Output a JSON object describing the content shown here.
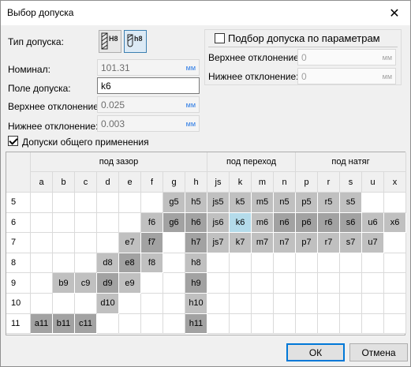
{
  "window": {
    "title": "Выбор допуска",
    "close_symbol": "✕"
  },
  "form": {
    "tolerance_type_label": "Тип допуска:",
    "btn_hole_text": "H8",
    "btn_shaft_text": "h8",
    "nominal_label": "Номинал:",
    "nominal_value": "101.31",
    "field_label": "Поле допуска:",
    "field_value": "k6",
    "upper_label": "Верхнее отклонение:",
    "upper_value": "0.025",
    "lower_label": "Нижнее отклонение:",
    "lower_value": "0.003",
    "unit": "мм"
  },
  "params": {
    "checkbox_label": "Подбор допуска по параметрам",
    "upper_label": "Верхнее отклонение:",
    "upper_value": "0",
    "lower_label": "Нижнее отклонение:",
    "lower_value": "0",
    "unit": "мм"
  },
  "general_checkbox_label": "Допуски общего применения",
  "grid": {
    "groups": [
      "под зазор",
      "под переход",
      "под натяг"
    ],
    "columns": [
      "a",
      "b",
      "c",
      "d",
      "e",
      "f",
      "g",
      "h",
      "js",
      "k",
      "m",
      "n",
      "p",
      "r",
      "s",
      "u",
      "x"
    ],
    "rows": [
      "5",
      "6",
      "7",
      "8",
      "9",
      "10",
      "11"
    ],
    "cells": [
      [
        "",
        "",
        "",
        "",
        "",
        "",
        "g5",
        "h5",
        "js5",
        "k5",
        "m5",
        "n5",
        "p5",
        "r5",
        "s5",
        "",
        ""
      ],
      [
        "",
        "",
        "",
        "",
        "",
        "f6",
        "g6",
        "h6",
        "js6",
        "k6",
        "m6",
        "n6",
        "p6",
        "r6",
        "s6",
        "u6",
        "x6"
      ],
      [
        "",
        "",
        "",
        "",
        "e7",
        "f7",
        "",
        "h7",
        "js7",
        "k7",
        "m7",
        "n7",
        "p7",
        "r7",
        "s7",
        "u7",
        ""
      ],
      [
        "",
        "",
        "",
        "d8",
        "e8",
        "f8",
        "",
        "h8",
        "",
        "",
        "",
        "",
        "",
        "",
        "",
        "",
        ""
      ],
      [
        "",
        "b9",
        "c9",
        "d9",
        "e9",
        "",
        "",
        "h9",
        "",
        "",
        "",
        "",
        "",
        "",
        "",
        "",
        ""
      ],
      [
        "",
        "",
        "",
        "d10",
        "",
        "",
        "",
        "h10",
        "",
        "",
        "",
        "",
        "",
        "",
        "",
        "",
        ""
      ],
      [
        "a11",
        "b11",
        "c11",
        "",
        "",
        "",
        "",
        "h11",
        "",
        "",
        "",
        "",
        "",
        "",
        "",
        "",
        ""
      ]
    ],
    "styles": [
      [
        "w",
        "w",
        "w",
        "w",
        "w",
        "w",
        "L",
        "L",
        "L",
        "L",
        "L",
        "L",
        "L",
        "L",
        "L",
        "w",
        "w"
      ],
      [
        "w",
        "w",
        "w",
        "w",
        "w",
        "L",
        "D",
        "D",
        "L",
        "S",
        "L",
        "D",
        "D",
        "D",
        "D",
        "L",
        "L"
      ],
      [
        "w",
        "w",
        "w",
        "w",
        "L",
        "D",
        "w",
        "D",
        "L",
        "L",
        "L",
        "L",
        "L",
        "L",
        "L",
        "L",
        "w"
      ],
      [
        "w",
        "w",
        "w",
        "L",
        "D",
        "L",
        "w",
        "L",
        "w",
        "w",
        "w",
        "w",
        "w",
        "w",
        "w",
        "w",
        "w"
      ],
      [
        "w",
        "L",
        "L",
        "D",
        "L",
        "w",
        "w",
        "D",
        "w",
        "w",
        "w",
        "w",
        "w",
        "w",
        "w",
        "w",
        "w"
      ],
      [
        "w",
        "w",
        "w",
        "L",
        "w",
        "w",
        "w",
        "L",
        "w",
        "w",
        "w",
        "w",
        "w",
        "w",
        "w",
        "w",
        "w"
      ],
      [
        "D",
        "D",
        "D",
        "w",
        "w",
        "w",
        "w",
        "D",
        "w",
        "w",
        "w",
        "w",
        "w",
        "w",
        "w",
        "w",
        "w"
      ]
    ],
    "colors": {
      "w": "#ffffff",
      "L": "#c0c0c0",
      "D": "#a2a2a2",
      "S": "#b4dbea"
    }
  },
  "buttons": {
    "ok": "ОК",
    "cancel": "Отмена"
  }
}
